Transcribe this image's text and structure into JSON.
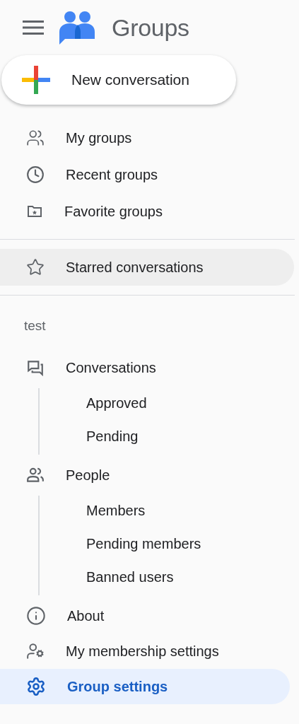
{
  "header": {
    "title": "Groups"
  },
  "new_button": {
    "label": "New conversation"
  },
  "main_nav": [
    {
      "kind": "groups",
      "label": "My groups",
      "selected": false
    },
    {
      "kind": "clock",
      "label": "Recent groups",
      "selected": false
    },
    {
      "kind": "folder_star",
      "label": "Favorite groups",
      "selected": false
    }
  ],
  "starred": {
    "kind": "star",
    "label": "Starred conversations",
    "selected": false,
    "hovered": true
  },
  "group": {
    "name": "test",
    "items": [
      {
        "kind": "chat",
        "label": "Conversations",
        "selected": false,
        "children": [
          {
            "label": "Approved",
            "selected": false
          },
          {
            "label": "Pending",
            "selected": false
          }
        ]
      },
      {
        "kind": "people",
        "label": "People",
        "selected": false,
        "children": [
          {
            "label": "Members",
            "selected": false
          },
          {
            "label": "Pending members",
            "selected": false
          },
          {
            "label": "Banned users",
            "selected": false
          }
        ]
      },
      {
        "kind": "info",
        "label": "About",
        "selected": false
      },
      {
        "kind": "user_gear",
        "label": "My membership settings",
        "selected": false
      },
      {
        "kind": "gear",
        "label": "Group settings",
        "selected": true
      }
    ]
  }
}
